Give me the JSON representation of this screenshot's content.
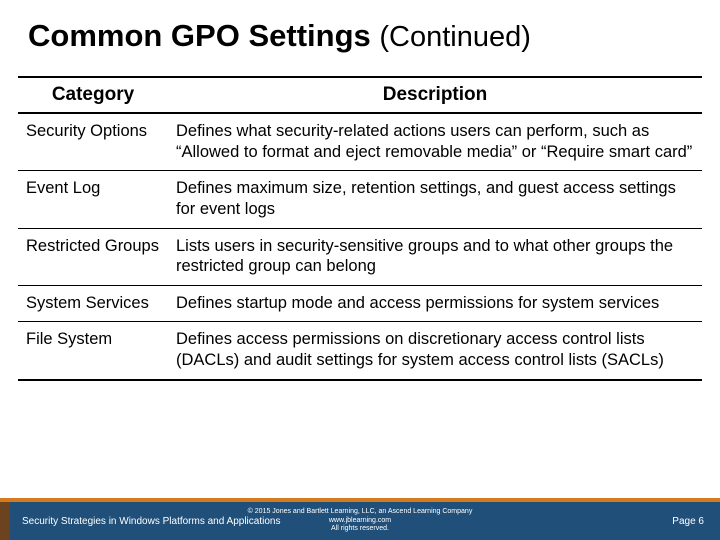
{
  "title_main": "Common GPO Settings ",
  "title_cont": "(Continued)",
  "headers": {
    "col1": "Category",
    "col2": "Description"
  },
  "rows": [
    {
      "category": "Security Options",
      "description": "Defines what security-related actions users can perform, such as “Allowed to format and eject removable media” or “Require smart card”"
    },
    {
      "category": "Event Log",
      "description": "Defines maximum size, retention settings, and guest access settings for event logs"
    },
    {
      "category": "Restricted Groups",
      "description": "Lists users in security-sensitive groups and to what other groups the restricted group can belong"
    },
    {
      "category": "System Services",
      "description": "Defines startup mode and access permissions for system services"
    },
    {
      "category": "File System",
      "description": "Defines access permissions on discretionary access control lists (DACLs) and audit settings for system access control lists (SACLs)"
    }
  ],
  "footer": {
    "left": "Security Strategies in Windows Platforms and Applications",
    "copyright": "© 2015 Jones and Bartlett Learning, LLC, an Ascend Learning Company",
    "url": "www.jblearning.com",
    "rights": "All rights reserved.",
    "page": "Page 6"
  },
  "chart_data": {
    "type": "table",
    "title": "Common GPO Settings (Continued)",
    "columns": [
      "Category",
      "Description"
    ],
    "rows": [
      [
        "Security Options",
        "Defines what security-related actions users can perform, such as “Allowed to format and eject removable media” or “Require smart card”"
      ],
      [
        "Event Log",
        "Defines maximum size, retention settings, and guest access settings for event logs"
      ],
      [
        "Restricted Groups",
        "Lists users in security-sensitive groups and to what other groups the restricted group can belong"
      ],
      [
        "System Services",
        "Defines startup mode and access permissions for system services"
      ],
      [
        "File System",
        "Defines access permissions on discretionary access control lists (DACLs) and audit settings for system access control lists (SACLs)"
      ]
    ]
  }
}
